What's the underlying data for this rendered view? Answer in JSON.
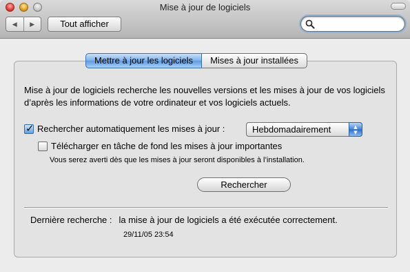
{
  "window": {
    "title": "Mise à jour de logiciels"
  },
  "toolbar": {
    "back_glyph": "◀",
    "forward_glyph": "▶",
    "show_all_label": "Tout afficher",
    "search_placeholder": ""
  },
  "tabs": [
    {
      "label": "Mettre à jour les logiciels",
      "active": true
    },
    {
      "label": "Mises à jour installées",
      "active": false
    }
  ],
  "panel": {
    "description": "Mise à jour de logiciels recherche les nouvelles versions et les mises à jour de vos logiciels d’après les informations de votre ordinateur et vos logiciels actuels.",
    "auto_check": {
      "label": "Rechercher automatiquement les mises à jour :",
      "checked": true,
      "frequency": "Hebdomadairement"
    },
    "background_download": {
      "label": "Télécharger en tâche de fond les mises à jour importantes",
      "checked": false,
      "note": "Vous serez averti dès que les mises à jour seront disponibles à l’installation."
    },
    "check_button_label": "Rechercher",
    "last_check": {
      "label": "Dernière recherche :",
      "value": "la mise à jour de logiciels a été exécutée correctement.",
      "date": "29/11/05 23:54"
    }
  },
  "colors": {
    "accent": "#5b9ae0",
    "search_focus": "#93b4d9"
  }
}
